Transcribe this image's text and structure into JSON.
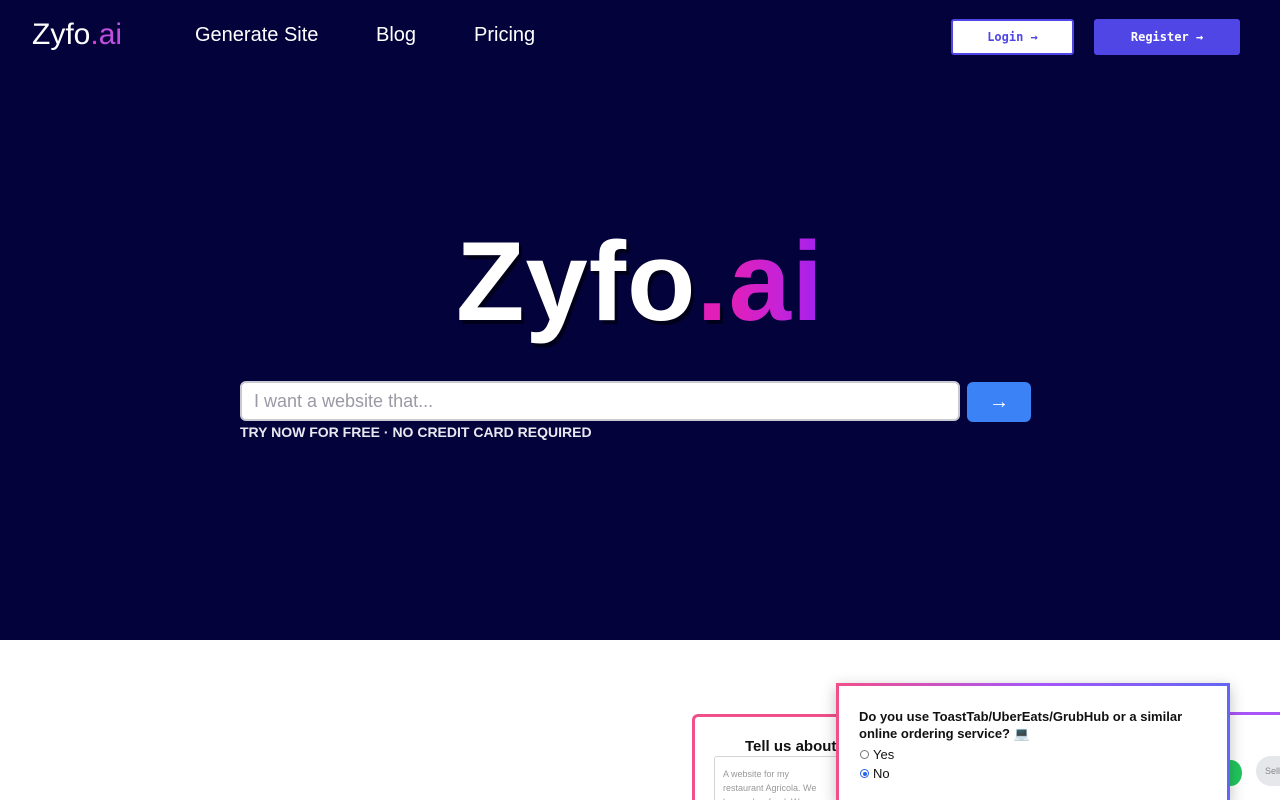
{
  "nav": {
    "brand": {
      "name": "Zyfo",
      "dot": ".",
      "suffix": "ai"
    },
    "links": [
      "Generate Site",
      "Blog",
      "Pricing"
    ],
    "login_label": "Login →",
    "register_label": "Register →"
  },
  "hero": {
    "logo": {
      "name": "Zyfo",
      "dot": ".",
      "suffix": "ai"
    },
    "input_placeholder": "I want a website that...",
    "submit_icon": "→",
    "tagline": "TRY NOW FOR FREE · NO CREDIT CARD REQUIRED"
  },
  "preview": {
    "back_title": "Tell us about",
    "back_text": "A website for my restaurant Agricola. We have a low food. We are like the A",
    "question": "Do you use ToastTab/UberEats/GrubHub or a similar online ordering service? 💻",
    "options": [
      "Yes",
      "No"
    ],
    "selected": "No",
    "pill_text": "Sell"
  },
  "colors": {
    "hero_bg": "#03023a",
    "accent": "#4f46e5",
    "go_button": "#3b82f6",
    "brand_pink": "#e21fb8",
    "brand_purple": "#a020f0"
  }
}
